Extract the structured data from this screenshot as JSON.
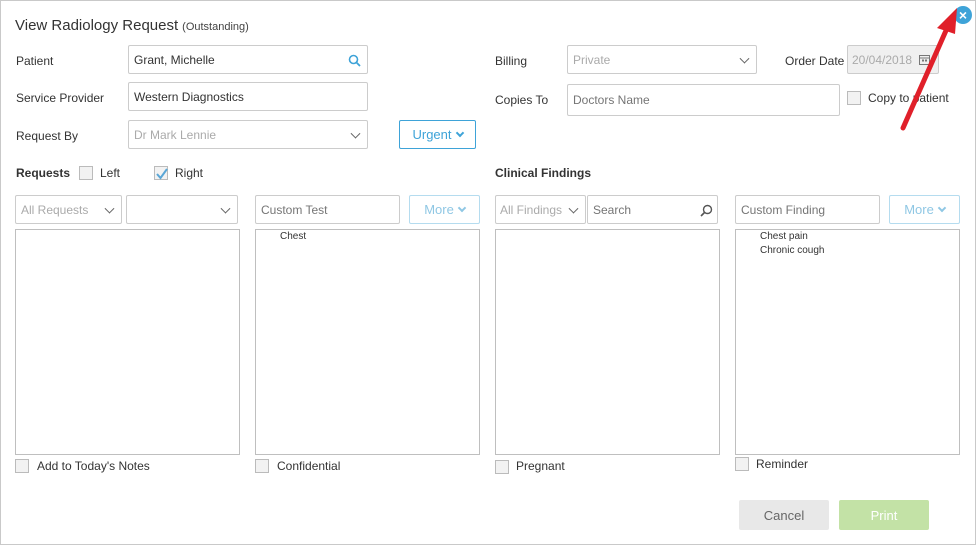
{
  "dialog": {
    "title": "View Radiology Request",
    "status": "(Outstanding)",
    "close_icon": "close-icon"
  },
  "form": {
    "patient_label": "Patient",
    "patient_value": "Grant, Michelle",
    "service_provider_label": "Service Provider",
    "service_provider_value": "Western Diagnostics",
    "request_by_label": "Request By",
    "request_by_value": "Dr Mark Lennie",
    "urgent_label": "Urgent",
    "billing_label": "Billing",
    "billing_value": "Private",
    "order_date_label": "Order Date",
    "order_date_value": "20/04/2018",
    "copies_to_label": "Copies To",
    "copies_to_placeholder": "Doctors Name",
    "copy_to_patient_label": "Copy to patient"
  },
  "requests": {
    "heading": "Requests",
    "left_label": "Left",
    "right_label": "Right",
    "right_checked": true,
    "filter_value": "All Requests",
    "custom_test_placeholder": "Custom Test",
    "more_label": "More",
    "selected_items": [
      "Chest"
    ],
    "add_notes_label": "Add to Today's Notes",
    "confidential_label": "Confidential"
  },
  "clinical": {
    "heading": "Clinical Findings",
    "filter_value": "All Findings",
    "search_placeholder": "Search",
    "custom_finding_placeholder": "Custom Finding",
    "more_label": "More",
    "selected_items": [
      "Chest pain",
      "Chronic cough"
    ],
    "pregnant_label": "Pregnant",
    "reminder_label": "Reminder"
  },
  "footer": {
    "cancel_label": "Cancel",
    "print_label": "Print"
  },
  "colors": {
    "accent": "#3ea3d8",
    "print_disabled": "#c3e2a6",
    "annotation_arrow": "#e0202a"
  }
}
